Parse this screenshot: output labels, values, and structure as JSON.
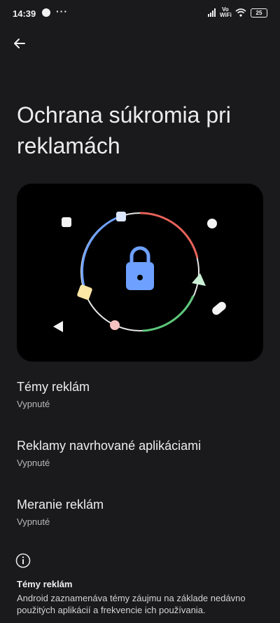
{
  "status_bar": {
    "time": "14:39",
    "overflow": "···",
    "network_label": "Vo WiFi",
    "battery": "25",
    "icons": [
      "messenger-icon",
      "signal-icon",
      "wifi-icon",
      "battery-icon"
    ]
  },
  "header": {
    "back_icon": "arrow-left-icon",
    "title": "Ochrana súkromia pri reklamách"
  },
  "hero": {
    "icon": "lock-icon",
    "colors": {
      "blue": "#6ea1ff",
      "red": "#e8625a",
      "green": "#5cc77a",
      "ring": "#ffffff"
    }
  },
  "settings": [
    {
      "title": "Témy reklám",
      "status": "Vypnuté"
    },
    {
      "title": "Reklamy navrhované aplikáciami",
      "status": "Vypnuté"
    },
    {
      "title": "Meranie reklám",
      "status": "Vypnuté"
    }
  ],
  "info": {
    "icon": "info-icon",
    "title": "Témy reklám",
    "body": "Android zaznamenáva témy záujmu na základe nedávno použitých aplikácií a frekvencie ich používania."
  }
}
